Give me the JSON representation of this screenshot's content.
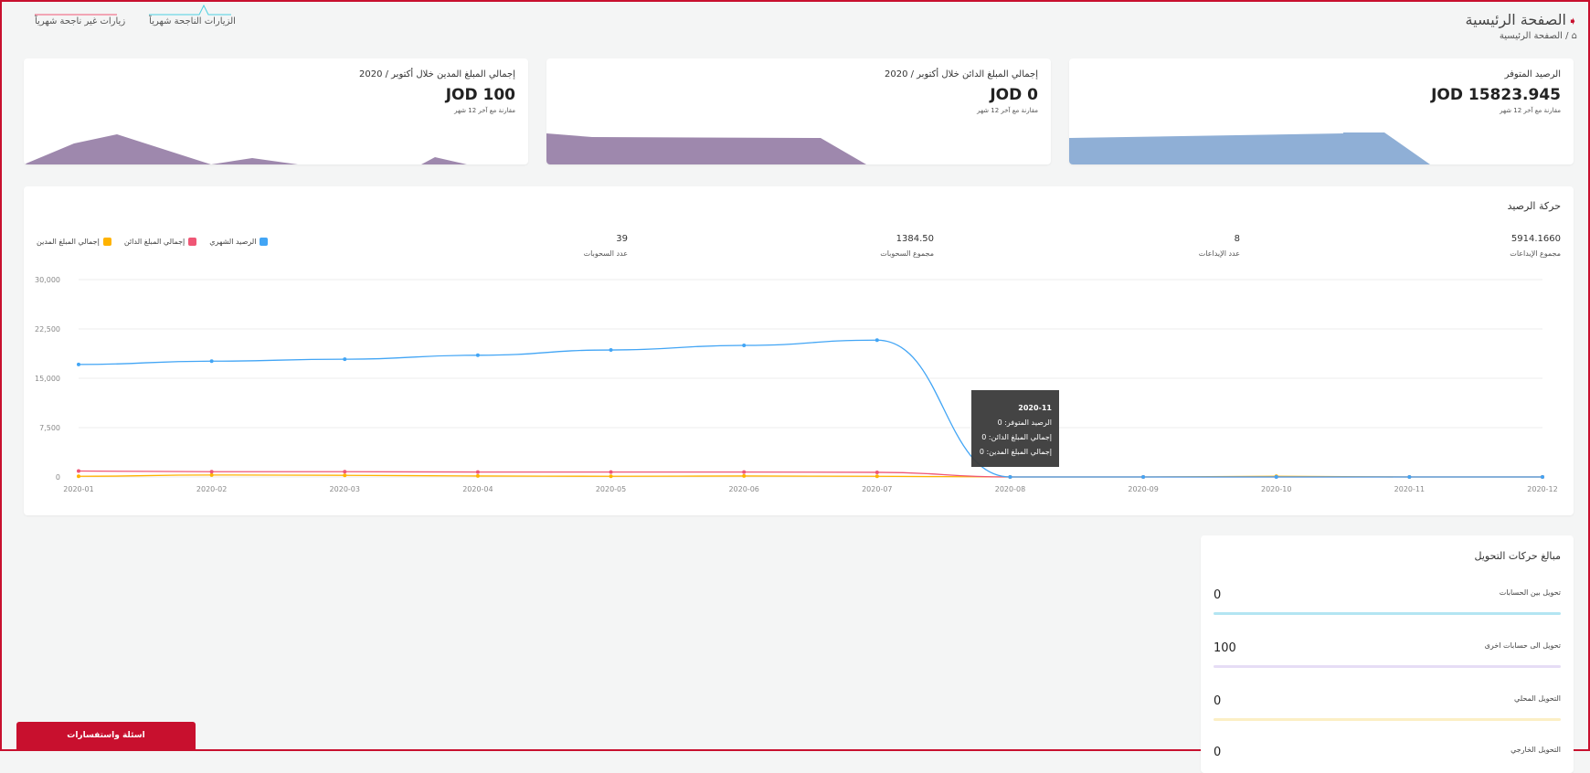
{
  "header": {
    "title": "الصفحة الرئيسية",
    "breadcrumb_home": "الصفحة الرئيسية",
    "legend_success": "الزيارات الناجحة شهرياً",
    "legend_failed": "زيارات غير ناجحة شهرياً"
  },
  "cards": [
    {
      "title": "الرصيد المتوفر",
      "value": "JOD 15823.945",
      "sub": "مقارنة مع آخر 12 شهر"
    },
    {
      "title": "إجمالي المبلغ الدائن خلال أكتوبر / 2020",
      "value": "JOD 0",
      "sub": "مقارنة مع آخر 12 شهر"
    },
    {
      "title": "إجمالي المبلغ المدين خلال أكتوبر / 2020",
      "value": "JOD 100",
      "sub": "مقارنة مع آخر 12 شهر"
    }
  ],
  "balance": {
    "title": "حركة الرصيد",
    "kpis": [
      {
        "value": "5914.1660",
        "label": "مجموع الإيداعات"
      },
      {
        "value": "8",
        "label": "عدد الإيداعات"
      },
      {
        "value": "1384.50",
        "label": "مجموع السحوبات"
      },
      {
        "value": "39",
        "label": "عدد السحوبات"
      }
    ],
    "legend": [
      "الرصيد الشهري",
      "إجمالي المبلغ الدائن",
      "إجمالي المبلغ المدين"
    ],
    "tooltip": {
      "period": "2020-11",
      "line1": "الرصيد المتوفر: 0",
      "line2": "إجمالي المبلغ الدائن: 0",
      "line3": "إجمالي المبلغ المدين: 0"
    }
  },
  "transfers": {
    "title": "مبالغ حركات التحويل",
    "rows": [
      {
        "label": "تحويل بين الحسابات",
        "value": "0"
      },
      {
        "label": "تحويل الى حسابات اخرى",
        "value": "100"
      },
      {
        "label": "التحويل المحلي",
        "value": "0"
      },
      {
        "label": "التحويل الخارجي",
        "value": "0"
      }
    ]
  },
  "footer": {
    "faq_button": "اسئلة واستفسارات"
  },
  "colors": {
    "accent": "#c8102e",
    "blue": "#42a5f5",
    "red": "#ef5675",
    "yellow": "#ffb300",
    "purple": "#9e88ad",
    "area_blue": "#8fafd6"
  },
  "chart_data": {
    "type": "line",
    "x": [
      "2020-01",
      "2020-02",
      "2020-03",
      "2020-04",
      "2020-05",
      "2020-06",
      "2020-07",
      "2020-08",
      "2020-09",
      "2020-10",
      "2020-11",
      "2020-12"
    ],
    "ylim": [
      0,
      30000
    ],
    "yticks": [
      "30,000",
      "22,500",
      "15,000",
      "7,500",
      "0"
    ],
    "series": [
      {
        "name": "الرصيد الشهري",
        "color": "#42a5f5",
        "values": [
          17100,
          17600,
          17900,
          18500,
          19300,
          20000,
          20800,
          0,
          0,
          0,
          0,
          0
        ]
      },
      {
        "name": "إجمالي المبلغ الدائن",
        "color": "#ef5675",
        "values": [
          900,
          800,
          800,
          750,
          750,
          750,
          700,
          0,
          0,
          0,
          0,
          0
        ]
      },
      {
        "name": "إجمالي المبلغ المدين",
        "color": "#ffb300",
        "values": [
          100,
          300,
          250,
          150,
          100,
          150,
          100,
          0,
          0,
          100,
          0,
          0
        ]
      }
    ]
  }
}
